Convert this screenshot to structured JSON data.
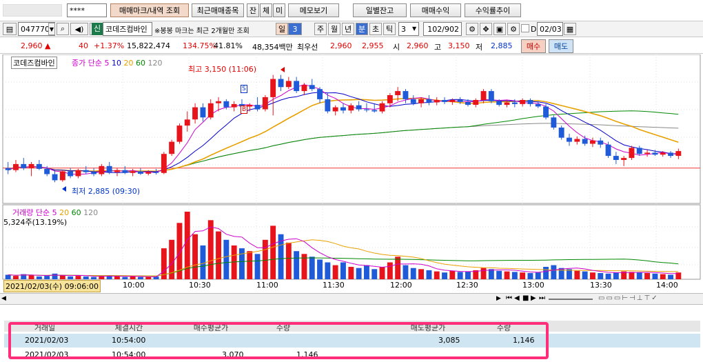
{
  "toolbar": {
    "password_mask": "****",
    "btn_trade_mark": "매매마크/내역 조회",
    "btn_recent_stocks": "최근매매종목",
    "btn_jan": "잔",
    "btn_che": "체",
    "btn_mi": "미",
    "btn_memo": "메모보기",
    "btn_daily_balance": "일별잔고",
    "btn_trade_profit": "매매수익",
    "btn_yield_trend": "수익률추이"
  },
  "stock_bar": {
    "code": "047770",
    "badge": "신",
    "name": "코데즈컴바인",
    "note": "※봉봉 마크는 최근 2개월만 조회",
    "periods": [
      "일",
      "주",
      "월",
      "년",
      "분",
      "초",
      "틱"
    ],
    "period_value": "3",
    "active_period": "분",
    "minute_value": "3",
    "count": "102/902",
    "date_label": "D",
    "date_value": "02/03"
  },
  "quote": {
    "price": "2,960",
    "change": "40",
    "change_pct": "+1.37%",
    "volume": "15,822,474",
    "vol_ratio": "134.75%",
    "turnover": "41.81%",
    "amount": "48,354백만",
    "ask_label": "최우선",
    "ask1": "2,960",
    "bid1": "2,955",
    "open_label": "시",
    "open": "2,960",
    "high_label": "고",
    "high": "3,150",
    "low_label": "저",
    "low": "2,885",
    "buy_btn": "매수",
    "sell_btn": "매도"
  },
  "chart": {
    "legend_name": "코데즈컴바인",
    "legend_ma": "종가 단순",
    "ma_periods": [
      "5",
      "10",
      "20",
      "60",
      "120"
    ],
    "ma_colors": [
      "#cc00cc",
      "#0000cc",
      "#e8a000",
      "#008800",
      "#888888"
    ],
    "high_annot": "최고 3,150 (11:06)",
    "low_annot": "최저 2,885 (09:30)",
    "mark_s": "S",
    "mark_b": "B",
    "vol_legend": "거래량 단순",
    "vol_periods": [
      "5",
      "20",
      "60",
      "120"
    ],
    "vol_value": "5,324주(13.19%)",
    "cursor_time": "2021/02/03(수) 09:06:00",
    "time_ticks": [
      "10:00",
      "10:30",
      "11:00",
      "11:30",
      "12:00",
      "12:30",
      "13:00",
      "13:30",
      "14:00"
    ]
  },
  "chart_data": {
    "type": "candlestick",
    "price_range": [
      2860,
      3180
    ],
    "candles": [
      [
        2920,
        2935,
        2905,
        2915
      ],
      [
        2915,
        2940,
        2910,
        2930
      ],
      [
        2930,
        2945,
        2915,
        2920
      ],
      [
        2920,
        2935,
        2900,
        2930
      ],
      [
        2930,
        2940,
        2915,
        2918
      ],
      [
        2918,
        2925,
        2900,
        2905
      ],
      [
        2905,
        2915,
        2885,
        2890
      ],
      [
        2890,
        2915,
        2886,
        2912
      ],
      [
        2912,
        2920,
        2895,
        2900
      ],
      [
        2900,
        2918,
        2895,
        2915
      ],
      [
        2915,
        2925,
        2905,
        2910
      ],
      [
        2910,
        2920,
        2900,
        2905
      ],
      [
        2905,
        2930,
        2900,
        2925
      ],
      [
        2925,
        2935,
        2905,
        2910
      ],
      [
        2910,
        2920,
        2900,
        2915
      ],
      [
        2915,
        2925,
        2905,
        2908
      ],
      [
        2908,
        2918,
        2900,
        2912
      ],
      [
        2912,
        2920,
        2903,
        2906
      ],
      [
        2906,
        2915,
        2902,
        2910
      ],
      [
        2910,
        2918,
        2904,
        2908
      ],
      [
        2908,
        2960,
        2905,
        2955
      ],
      [
        2955,
        2990,
        2950,
        2985
      ],
      [
        2985,
        3030,
        2980,
        3025
      ],
      [
        3025,
        3060,
        3010,
        3040
      ],
      [
        3040,
        3080,
        3030,
        3070
      ],
      [
        3070,
        3080,
        3035,
        3045
      ],
      [
        3045,
        3090,
        3040,
        3080
      ],
      [
        3080,
        3095,
        3060,
        3085
      ],
      [
        3085,
        3090,
        3065,
        3070
      ],
      [
        3070,
        3085,
        3060,
        3078
      ],
      [
        3078,
        3090,
        3068,
        3072
      ],
      [
        3072,
        3080,
        3060,
        3076
      ],
      [
        3076,
        3095,
        3060,
        3065
      ],
      [
        3065,
        3100,
        3060,
        3095
      ],
      [
        3095,
        3150,
        3050,
        3140
      ],
      [
        3140,
        3150,
        3110,
        3120
      ],
      [
        3120,
        3145,
        3115,
        3135
      ],
      [
        3135,
        3145,
        3105,
        3110
      ],
      [
        3110,
        3130,
        3100,
        3125
      ],
      [
        3125,
        3140,
        3110,
        3115
      ],
      [
        3115,
        3120,
        3080,
        3090
      ],
      [
        3090,
        3105,
        3055,
        3060
      ],
      [
        3060,
        3075,
        3050,
        3070
      ],
      [
        3070,
        3080,
        3055,
        3062
      ],
      [
        3062,
        3080,
        3055,
        3075
      ],
      [
        3075,
        3085,
        3060,
        3065
      ],
      [
        3065,
        3080,
        3058,
        3063
      ],
      [
        3063,
        3078,
        3057,
        3060
      ],
      [
        3060,
        3085,
        3055,
        3080
      ],
      [
        3080,
        3105,
        3070,
        3100
      ],
      [
        3100,
        3120,
        3085,
        3110
      ],
      [
        3110,
        3115,
        3080,
        3090
      ],
      [
        3090,
        3100,
        3075,
        3080
      ],
      [
        3080,
        3095,
        3070,
        3090
      ],
      [
        3090,
        3100,
        3075,
        3082
      ],
      [
        3082,
        3095,
        3075,
        3088
      ],
      [
        3088,
        3095,
        3078,
        3083
      ],
      [
        3083,
        3092,
        3076,
        3088
      ],
      [
        3088,
        3095,
        3078,
        3083
      ],
      [
        3083,
        3090,
        3072,
        3076
      ],
      [
        3076,
        3092,
        3070,
        3088
      ],
      [
        3088,
        3115,
        3080,
        3110
      ],
      [
        3110,
        3115,
        3080,
        3085
      ],
      [
        3085,
        3090,
        3072,
        3076
      ],
      [
        3076,
        3088,
        3070,
        3082
      ],
      [
        3082,
        3090,
        3070,
        3078
      ],
      [
        3078,
        3092,
        3072,
        3088
      ],
      [
        3088,
        3092,
        3072,
        3078
      ],
      [
        3078,
        3085,
        3068,
        3072
      ],
      [
        3072,
        3078,
        3040,
        3045
      ],
      [
        3045,
        3050,
        3015,
        3020
      ],
      [
        3020,
        3025,
        2990,
        2995
      ],
      [
        2995,
        3005,
        2975,
        2985
      ],
      [
        2985,
        2998,
        2978,
        2992
      ],
      [
        2992,
        3000,
        2975,
        2980
      ],
      [
        2980,
        2995,
        2972,
        2988
      ],
      [
        2988,
        2995,
        2970,
        2978
      ],
      [
        2978,
        2985,
        2945,
        2950
      ],
      [
        2950,
        2960,
        2930,
        2940
      ],
      [
        2940,
        2950,
        2925,
        2945
      ],
      [
        2945,
        2975,
        2940,
        2970
      ],
      [
        2970,
        2975,
        2950,
        2955
      ],
      [
        2955,
        2965,
        2948,
        2958
      ],
      [
        2958,
        2965,
        2950,
        2953
      ],
      [
        2953,
        2962,
        2948,
        2958
      ],
      [
        2958,
        2962,
        2945,
        2950
      ],
      [
        2950,
        2968,
        2942,
        2962
      ]
    ],
    "volumes": [
      8,
      6,
      9,
      7,
      5,
      6,
      10,
      7,
      5,
      6,
      5,
      4,
      6,
      7,
      5,
      4,
      5,
      4,
      4,
      5,
      55,
      70,
      100,
      120,
      80,
      60,
      105,
      85,
      70,
      60,
      55,
      50,
      45,
      70,
      95,
      80,
      65,
      50,
      45,
      40,
      35,
      30,
      25,
      30,
      22,
      20,
      25,
      18,
      22,
      30,
      40,
      25,
      20,
      18,
      16,
      14,
      12,
      15,
      13,
      14,
      16,
      20,
      18,
      15,
      14,
      13,
      12,
      11,
      12,
      22,
      25,
      20,
      18,
      15,
      14,
      12,
      11,
      10,
      12,
      14,
      13,
      12,
      11,
      10,
      9,
      8,
      12
    ]
  },
  "table": {
    "headers": [
      "거래일",
      "체결시간",
      "매수평균가",
      "수량",
      "매도평균가",
      "수량"
    ],
    "rows": [
      {
        "date": "2021/02/03",
        "time": "10:54:00",
        "buy_avg": "",
        "buy_qty": "",
        "sell_avg": "3,085",
        "sell_qty": "1,146"
      },
      {
        "date": "2021/02/03",
        "time": "10:54:00",
        "buy_avg": "3,070",
        "buy_qty": "1,146",
        "sell_avg": "",
        "sell_qty": ""
      }
    ]
  }
}
